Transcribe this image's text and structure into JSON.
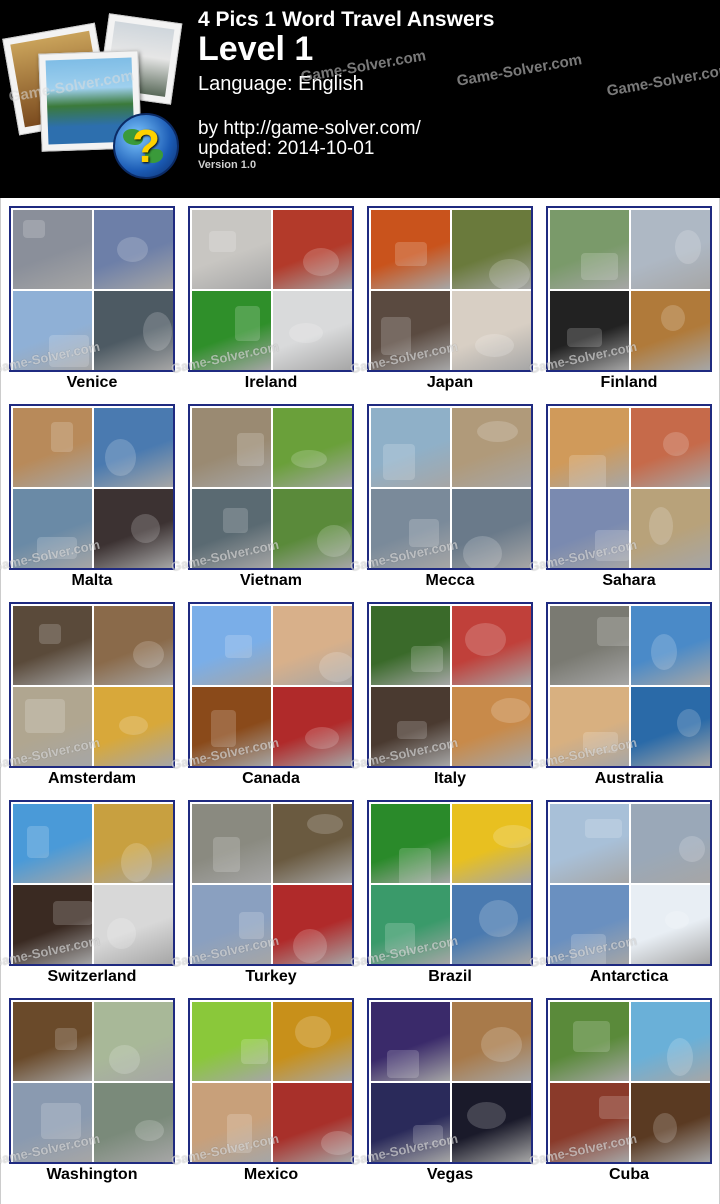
{
  "header": {
    "title": "4 Pics 1 Word Travel Answers",
    "level": "Level 1",
    "language": "Language: English",
    "by": "by http://game-solver.com/",
    "updated": "updated: 2014-10-01",
    "version": "Version 1.0",
    "watermark": "Game-Solver.com"
  },
  "watermark": "Game-Solver.com",
  "answers": [
    {
      "word": "Venice",
      "colors": [
        "#8a8f9a",
        "#6d7fa8",
        "#8fb0d6",
        "#4d5a63"
      ]
    },
    {
      "word": "Ireland",
      "colors": [
        "#c8c6c2",
        "#b33a2a",
        "#2f8f2a",
        "#d9dadb"
      ]
    },
    {
      "word": "Japan",
      "colors": [
        "#c9531c",
        "#6a7a3c",
        "#5a4a40",
        "#d8cfc4"
      ]
    },
    {
      "word": "Finland",
      "colors": [
        "#7a9a6a",
        "#aeb8c4",
        "#222222",
        "#b07a3a"
      ]
    },
    {
      "word": "Malta",
      "colors": [
        "#b88a5a",
        "#4a7ab0",
        "#6a8aa6",
        "#3c3232"
      ]
    },
    {
      "word": "Vietnam",
      "colors": [
        "#9a8a72",
        "#6aa03a",
        "#5a6a72",
        "#5a8a3a"
      ]
    },
    {
      "word": "Mecca",
      "colors": [
        "#8fb0c8",
        "#b09a7a",
        "#7a8a9a",
        "#6a7a8a"
      ]
    },
    {
      "word": "Sahara",
      "colors": [
        "#d09a5a",
        "#c66a4a",
        "#7a8ab0",
        "#b8a27a"
      ]
    },
    {
      "word": "Amsterdam",
      "colors": [
        "#5a4a3a",
        "#8a6a4a",
        "#b0a690",
        "#d8a83a"
      ]
    },
    {
      "word": "Canada",
      "colors": [
        "#7aaee8",
        "#d8b08a",
        "#8a4a1a",
        "#b02a2a"
      ]
    },
    {
      "word": "Italy",
      "colors": [
        "#3a6a2a",
        "#c0403a",
        "#4a3a30",
        "#c88a4a"
      ]
    },
    {
      "word": "Australia",
      "colors": [
        "#7a7a72",
        "#4a8ac8",
        "#d8b080",
        "#2a6aa8"
      ]
    },
    {
      "word": "Switzerland",
      "colors": [
        "#4a9ad8",
        "#c8a040",
        "#3a2a22",
        "#d8d8d8"
      ]
    },
    {
      "word": "Turkey",
      "colors": [
        "#8a8a80",
        "#6a5a40",
        "#8aa0c0",
        "#b02a2a"
      ]
    },
    {
      "word": "Brazil",
      "colors": [
        "#2a8a2a",
        "#e8c020",
        "#3a9a6a",
        "#4a7ab0"
      ]
    },
    {
      "word": "Antarctica",
      "colors": [
        "#a8c0d8",
        "#9aa8b8",
        "#6a90c0",
        "#e8eef4"
      ]
    },
    {
      "word": "Washington",
      "colors": [
        "#6a4a2a",
        "#a8b898",
        "#8a9ab0",
        "#7a8a7a"
      ]
    },
    {
      "word": "Mexico",
      "colors": [
        "#8ac83a",
        "#c8901a",
        "#c8a07a",
        "#a8302a"
      ]
    },
    {
      "word": "Vegas",
      "colors": [
        "#3a2a6a",
        "#a87a4a",
        "#2a2a5a",
        "#1a1a2a"
      ]
    },
    {
      "word": "Cuba",
      "colors": [
        "#5a8a3a",
        "#6ab0d8",
        "#8a3a2a",
        "#5a3a22"
      ]
    }
  ]
}
